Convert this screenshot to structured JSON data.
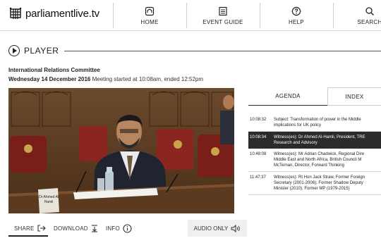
{
  "header": {
    "logo_text": "parliamentlive.tv",
    "nav": [
      {
        "label": "HOME",
        "icon": "home-icon"
      },
      {
        "label": "EVENT GUIDE",
        "icon": "event-guide-icon"
      },
      {
        "label": "HELP",
        "icon": "help-icon"
      },
      {
        "label": "SEARCH",
        "icon": "search-icon"
      }
    ]
  },
  "player": {
    "heading": "PLAYER",
    "committee": "International Relations Committee",
    "date": "Wednesday 14 December 2016",
    "status": "Meeting started at 10:08am, ended 12:52pm",
    "nameplate": "Dr Ahmed Al Hamli"
  },
  "controls": {
    "share": "SHARE",
    "download": "DOWNLOAD",
    "info": "INFO",
    "audio_only": "AUDIO ONLY"
  },
  "tabs": {
    "agenda": "AGENDA",
    "index": "INDEX"
  },
  "agenda": [
    {
      "time": "10:08:32",
      "lines": [
        "Subject: Transformation of power in the Middle",
        "implications for UK policy"
      ],
      "active": false
    },
    {
      "time": "10:08:34",
      "lines": [
        "Witness(es): Dr Ahmed Al-Hamli, President, TRE",
        "Research and Advisory"
      ],
      "active": true
    },
    {
      "time": "10:48:08",
      "lines": [
        "Witness(es): Mr Adrian Chadwick, Regional Dire",
        "Middle East and North Africa, British Council M",
        "McTernan, Director, Forward Thinking"
      ],
      "active": false
    },
    {
      "time": "11:47:37",
      "lines": [
        "Witness(es): Rt Hon Jack Straw, Former Foreign",
        "Secretary (2001-2006); Former Shadow Deputy",
        "Minister (2010); Former MP (1979-2015)"
      ],
      "active": false
    }
  ],
  "colors": {
    "active_row": "#2b2b2b",
    "text": "#222222"
  }
}
